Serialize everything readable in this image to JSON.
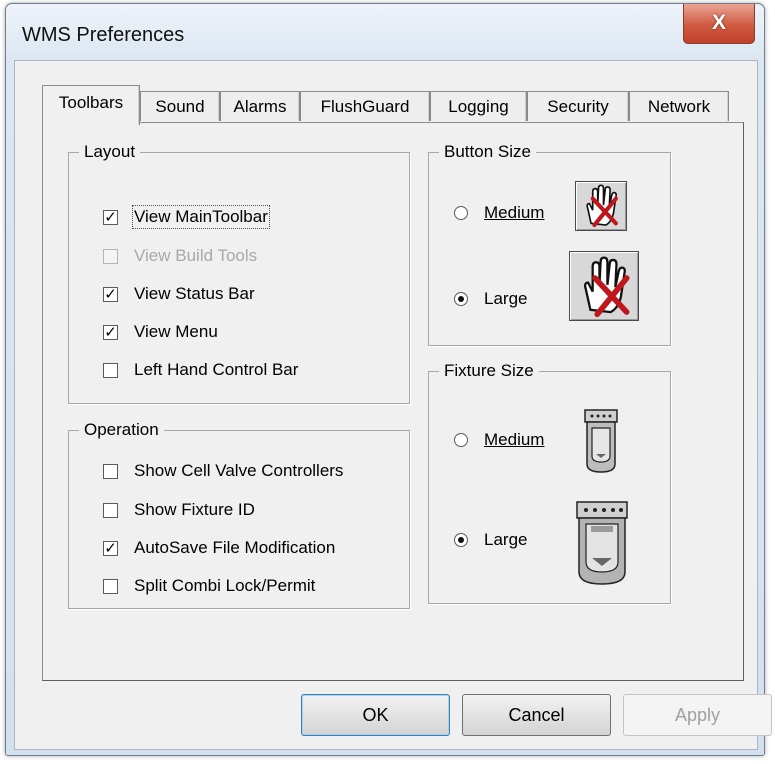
{
  "window": {
    "title": "WMS Preferences",
    "close_label": "X"
  },
  "tabs": [
    "Toolbars",
    "Sound",
    "Alarms",
    "FlushGuard",
    "Logging",
    "Security",
    "Network"
  ],
  "active_tab": "Toolbars",
  "layout": {
    "title": "Layout",
    "items": [
      {
        "label": "View MainToolbar",
        "checked": true,
        "enabled": true
      },
      {
        "label": "View Build Tools",
        "checked": false,
        "enabled": false
      },
      {
        "label": "View Status Bar",
        "checked": true,
        "enabled": true
      },
      {
        "label": "View Menu",
        "checked": true,
        "enabled": true
      },
      {
        "label": "Left Hand Control Bar",
        "checked": false,
        "enabled": true
      }
    ]
  },
  "operation": {
    "title": "Operation",
    "items": [
      {
        "label": "Show Cell Valve Controllers",
        "checked": false
      },
      {
        "label": "Show Fixture ID",
        "checked": false
      },
      {
        "label": "AutoSave File Modification",
        "checked": true
      },
      {
        "label": "Split Combi Lock/Permit",
        "checked": false
      }
    ]
  },
  "button_size": {
    "title": "Button Size",
    "options": [
      "Medium",
      "Large"
    ],
    "selected": "Large"
  },
  "fixture_size": {
    "title": "Fixture Size",
    "options": [
      "Medium",
      "Large"
    ],
    "selected": "Large"
  },
  "buttons": {
    "ok": "OK",
    "cancel": "Cancel",
    "apply": "Apply"
  },
  "colors": {
    "close_button": "#c9452f",
    "cross_red": "#c0171c",
    "titlebar": "#dbe6f2"
  },
  "icons": {
    "button_preview": "hand-stop-icon",
    "fixture_preview": "urinal-icon"
  }
}
